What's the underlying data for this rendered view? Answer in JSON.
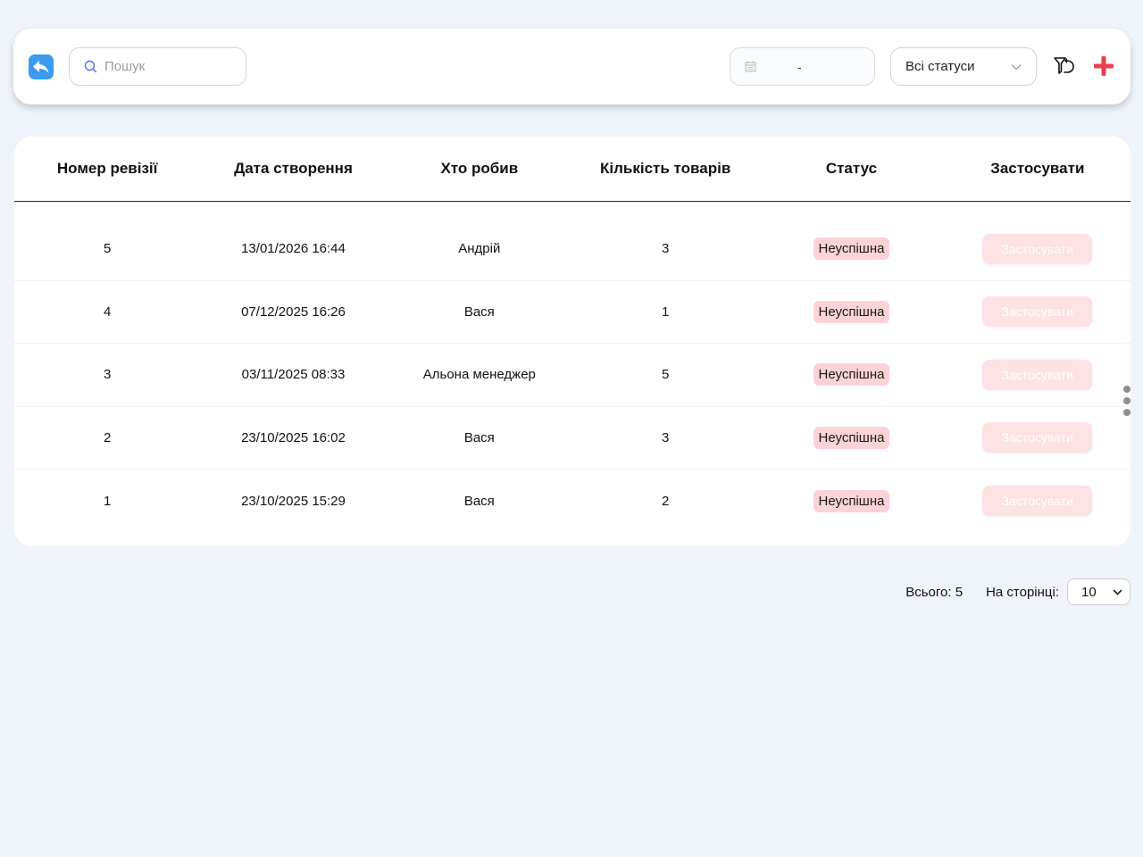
{
  "toolbar": {
    "search_placeholder": "Пошук",
    "date_separator": "-",
    "status_filter": "Всі статуси"
  },
  "table": {
    "headers": [
      "Номер ревізії",
      "Дата створення",
      "Хто робив",
      "Кількість товарів",
      "Статус",
      "Застосувати"
    ],
    "rows": [
      {
        "number": "5",
        "date": "13/01/2026 16:44",
        "who": "Андрій",
        "count": "3",
        "status": "Неуспішна",
        "action": "Застосувати"
      },
      {
        "number": "4",
        "date": "07/12/2025 16:26",
        "who": "Вася",
        "count": "1",
        "status": "Неуспішна",
        "action": "Застосувати"
      },
      {
        "number": "3",
        "date": "03/11/2025 08:33",
        "who": "Альона менеджер",
        "count": "5",
        "status": "Неуспішна",
        "action": "Застосувати"
      },
      {
        "number": "2",
        "date": "23/10/2025 16:02",
        "who": "Вася",
        "count": "3",
        "status": "Неуспішна",
        "action": "Застосувати"
      },
      {
        "number": "1",
        "date": "23/10/2025 15:29",
        "who": "Вася",
        "count": "2",
        "status": "Неуспішна",
        "action": "Застосувати"
      }
    ]
  },
  "pagination": {
    "total_label": "Всього: 5",
    "per_page_label": "На сторінці:",
    "per_page_value": "10"
  },
  "colors": {
    "accent_blue": "#3a9bf0",
    "add_red": "#e8414d",
    "badge_bg": "#fbd3d6",
    "apply_bg": "#fde1e3"
  }
}
